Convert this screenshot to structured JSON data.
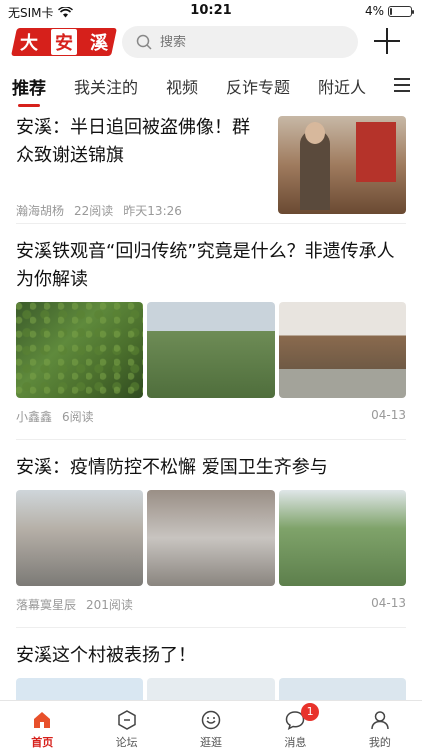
{
  "status_bar": {
    "carrier": "无SIM卡",
    "time": "10:21",
    "battery": "4%",
    "battery_level": 0.04
  },
  "header": {
    "logo": "大安溪",
    "search_placeholder": "搜索"
  },
  "tabs": [
    {
      "label": "推荐",
      "active": true
    },
    {
      "label": "我关注的",
      "active": false
    },
    {
      "label": "视频",
      "active": false
    },
    {
      "label": "反诈专题",
      "active": false
    },
    {
      "label": "附近人",
      "active": false
    }
  ],
  "articles": [
    {
      "title": "安溪：半日追回被盗佛像！群众致谢送锦旗",
      "author": "瀚海胡杨",
      "reads": "22阅读",
      "time": "昨天13:26"
    },
    {
      "title": "安溪铁观音“回归传统”究竟是什么？非遗传承人为你解读",
      "author": "小鑫鑫",
      "reads": "6阅读",
      "time": "04-13"
    },
    {
      "title": "安溪：疫情防控不松懈 爱国卫生齐参与",
      "author": "落幕寞星辰",
      "reads": "201阅读",
      "time": "04-13"
    },
    {
      "title": "安溪这个村被表扬了！"
    }
  ],
  "tabbar": {
    "items": [
      {
        "label": "首页",
        "active": true
      },
      {
        "label": "论坛",
        "active": false
      },
      {
        "label": "逛逛",
        "active": false
      },
      {
        "label": "消息",
        "active": false,
        "badge": "1"
      },
      {
        "label": "我的",
        "active": false
      }
    ]
  },
  "colors": {
    "accent": "#d6201b",
    "badge": "#e8322b"
  }
}
